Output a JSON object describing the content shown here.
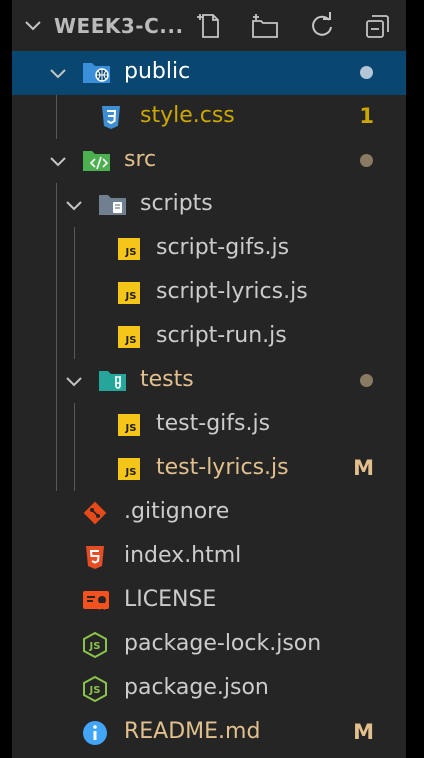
{
  "explorer": {
    "title": "WEEK3-C...",
    "actions": [
      "new-file-icon",
      "new-folder-icon",
      "refresh-icon",
      "collapse-all-icon"
    ]
  },
  "colors": {
    "panel_bg": "#252526",
    "selected_bg": "#094771",
    "default_text": "#cccccc",
    "modified_text": "#e2c08d",
    "warning_text": "#cca700",
    "selected_text": "#ffffff",
    "dot": "#8a8a8a",
    "selected_dot": "#b3c5d6"
  },
  "tree": {
    "public": {
      "label": "public",
      "status": "dot"
    },
    "style_css": {
      "label": "style.css",
      "badge": "1"
    },
    "src": {
      "label": "src",
      "status": "dot"
    },
    "scripts": {
      "label": "scripts"
    },
    "script_gifs": {
      "label": "script-gifs.js"
    },
    "script_lyrics": {
      "label": "script-lyrics.js"
    },
    "script_run": {
      "label": "script-run.js"
    },
    "tests": {
      "label": "tests",
      "status": "dot"
    },
    "test_gifs": {
      "label": "test-gifs.js"
    },
    "test_lyrics": {
      "label": "test-lyrics.js",
      "badge": "M"
    },
    "gitignore": {
      "label": ".gitignore"
    },
    "index_html": {
      "label": "index.html"
    },
    "license": {
      "label": "LICENSE"
    },
    "package_lock": {
      "label": "package-lock.json"
    },
    "package_json": {
      "label": "package.json"
    },
    "readme": {
      "label": "README.md",
      "badge": "M"
    }
  },
  "js_badge_text": "JS"
}
